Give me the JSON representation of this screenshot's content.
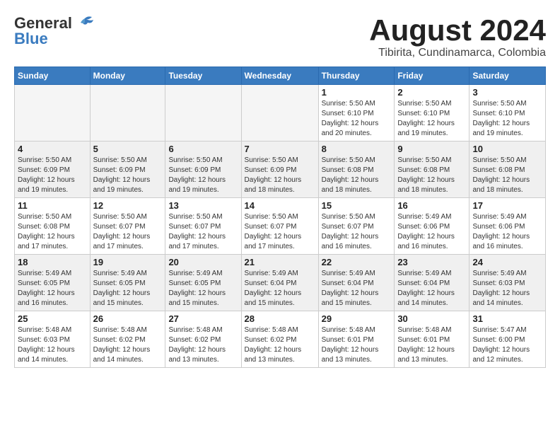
{
  "header": {
    "logo_general": "General",
    "logo_blue": "Blue",
    "month_title": "August 2024",
    "location": "Tibirita, Cundinamarca, Colombia"
  },
  "calendar": {
    "days_of_week": [
      "Sunday",
      "Monday",
      "Tuesday",
      "Wednesday",
      "Thursday",
      "Friday",
      "Saturday"
    ],
    "weeks": [
      {
        "bg": "light",
        "cells": [
          {
            "empty": true
          },
          {
            "empty": true
          },
          {
            "empty": true
          },
          {
            "empty": true
          },
          {
            "day": "1",
            "sunrise": "5:50 AM",
            "sunset": "6:10 PM",
            "daylight": "12 hours and 20 minutes."
          },
          {
            "day": "2",
            "sunrise": "5:50 AM",
            "sunset": "6:10 PM",
            "daylight": "12 hours and 19 minutes."
          },
          {
            "day": "3",
            "sunrise": "5:50 AM",
            "sunset": "6:10 PM",
            "daylight": "12 hours and 19 minutes."
          }
        ]
      },
      {
        "bg": "gray",
        "cells": [
          {
            "day": "4",
            "sunrise": "5:50 AM",
            "sunset": "6:09 PM",
            "daylight": "12 hours and 19 minutes."
          },
          {
            "day": "5",
            "sunrise": "5:50 AM",
            "sunset": "6:09 PM",
            "daylight": "12 hours and 19 minutes."
          },
          {
            "day": "6",
            "sunrise": "5:50 AM",
            "sunset": "6:09 PM",
            "daylight": "12 hours and 19 minutes."
          },
          {
            "day": "7",
            "sunrise": "5:50 AM",
            "sunset": "6:09 PM",
            "daylight": "12 hours and 18 minutes."
          },
          {
            "day": "8",
            "sunrise": "5:50 AM",
            "sunset": "6:08 PM",
            "daylight": "12 hours and 18 minutes."
          },
          {
            "day": "9",
            "sunrise": "5:50 AM",
            "sunset": "6:08 PM",
            "daylight": "12 hours and 18 minutes."
          },
          {
            "day": "10",
            "sunrise": "5:50 AM",
            "sunset": "6:08 PM",
            "daylight": "12 hours and 18 minutes."
          }
        ]
      },
      {
        "bg": "light",
        "cells": [
          {
            "day": "11",
            "sunrise": "5:50 AM",
            "sunset": "6:08 PM",
            "daylight": "12 hours and 17 minutes."
          },
          {
            "day": "12",
            "sunrise": "5:50 AM",
            "sunset": "6:07 PM",
            "daylight": "12 hours and 17 minutes."
          },
          {
            "day": "13",
            "sunrise": "5:50 AM",
            "sunset": "6:07 PM",
            "daylight": "12 hours and 17 minutes."
          },
          {
            "day": "14",
            "sunrise": "5:50 AM",
            "sunset": "6:07 PM",
            "daylight": "12 hours and 17 minutes."
          },
          {
            "day": "15",
            "sunrise": "5:50 AM",
            "sunset": "6:07 PM",
            "daylight": "12 hours and 16 minutes."
          },
          {
            "day": "16",
            "sunrise": "5:49 AM",
            "sunset": "6:06 PM",
            "daylight": "12 hours and 16 minutes."
          },
          {
            "day": "17",
            "sunrise": "5:49 AM",
            "sunset": "6:06 PM",
            "daylight": "12 hours and 16 minutes."
          }
        ]
      },
      {
        "bg": "gray",
        "cells": [
          {
            "day": "18",
            "sunrise": "5:49 AM",
            "sunset": "6:05 PM",
            "daylight": "12 hours and 16 minutes."
          },
          {
            "day": "19",
            "sunrise": "5:49 AM",
            "sunset": "6:05 PM",
            "daylight": "12 hours and 15 minutes."
          },
          {
            "day": "20",
            "sunrise": "5:49 AM",
            "sunset": "6:05 PM",
            "daylight": "12 hours and 15 minutes."
          },
          {
            "day": "21",
            "sunrise": "5:49 AM",
            "sunset": "6:04 PM",
            "daylight": "12 hours and 15 minutes."
          },
          {
            "day": "22",
            "sunrise": "5:49 AM",
            "sunset": "6:04 PM",
            "daylight": "12 hours and 15 minutes."
          },
          {
            "day": "23",
            "sunrise": "5:49 AM",
            "sunset": "6:04 PM",
            "daylight": "12 hours and 14 minutes."
          },
          {
            "day": "24",
            "sunrise": "5:49 AM",
            "sunset": "6:03 PM",
            "daylight": "12 hours and 14 minutes."
          }
        ]
      },
      {
        "bg": "light",
        "cells": [
          {
            "day": "25",
            "sunrise": "5:48 AM",
            "sunset": "6:03 PM",
            "daylight": "12 hours and 14 minutes."
          },
          {
            "day": "26",
            "sunrise": "5:48 AM",
            "sunset": "6:02 PM",
            "daylight": "12 hours and 14 minutes."
          },
          {
            "day": "27",
            "sunrise": "5:48 AM",
            "sunset": "6:02 PM",
            "daylight": "12 hours and 13 minutes."
          },
          {
            "day": "28",
            "sunrise": "5:48 AM",
            "sunset": "6:02 PM",
            "daylight": "12 hours and 13 minutes."
          },
          {
            "day": "29",
            "sunrise": "5:48 AM",
            "sunset": "6:01 PM",
            "daylight": "12 hours and 13 minutes."
          },
          {
            "day": "30",
            "sunrise": "5:48 AM",
            "sunset": "6:01 PM",
            "daylight": "12 hours and 13 minutes."
          },
          {
            "day": "31",
            "sunrise": "5:47 AM",
            "sunset": "6:00 PM",
            "daylight": "12 hours and 12 minutes."
          }
        ]
      }
    ]
  }
}
